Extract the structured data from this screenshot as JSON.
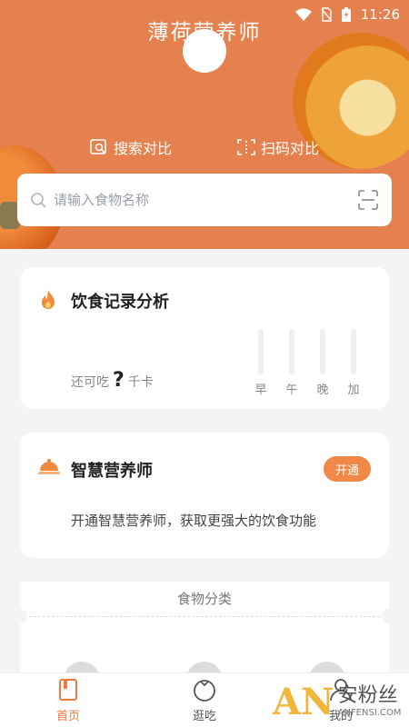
{
  "status": {
    "time": "11:26"
  },
  "header": {
    "title": "薄荷营养师",
    "search_compare": "搜索对比",
    "scan_compare": "扫码对比",
    "search_placeholder": "请输入食物名称"
  },
  "diet_card": {
    "title": "饮食记录分析",
    "remain_label": "还可吃",
    "remain_value": "?",
    "remain_unit": "千卡",
    "meals": [
      "早",
      "午",
      "晚",
      "加"
    ]
  },
  "nutritionist_card": {
    "title": "智慧营养师",
    "button": "开通",
    "description": "开通智慧营养师，获取更强大的饮食功能"
  },
  "category": {
    "title": "食物分类"
  },
  "nav": {
    "home": "首页",
    "browse": "逛吃",
    "mine": "我的"
  },
  "watermark": {
    "logo": "AN",
    "text": "安粉丝",
    "sub": "ANFENSI.COM"
  },
  "colors": {
    "accent": "#e5814f",
    "button": "#f18848",
    "active_tab": "#ef7a3e"
  }
}
